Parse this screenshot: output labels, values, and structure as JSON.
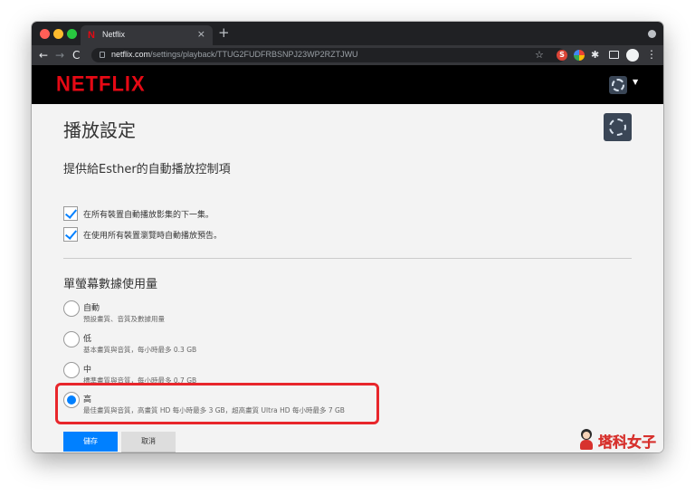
{
  "browser": {
    "tab_title": "Netflix",
    "tab_close": "×",
    "new_tab": "+",
    "url_host": "netflix.com",
    "url_path": "/settings/playback/TTUG2FUDFRBSNPJ23WP2RZTJWU",
    "nav_back": "←",
    "nav_forward": "→",
    "nav_reload": "C",
    "star": "☆",
    "ext_s_label": "S",
    "puzzle": "✱",
    "menu": "⋮"
  },
  "header": {
    "logo": "NETFLIX",
    "caret": "▼"
  },
  "page": {
    "title": "播放設定",
    "autoplay_section_title": "提供給Esther的自動播放控制項",
    "autoplay_options": [
      {
        "label": "在所有裝置自動播放影集的下一集。",
        "checked": true
      },
      {
        "label": "在使用所有裝置瀏覽時自動播放預告。",
        "checked": true
      }
    ],
    "data_section_title": "單螢幕數據使用量",
    "data_options": [
      {
        "label": "自動",
        "desc": "預設畫質、音質及數據用量",
        "selected": false
      },
      {
        "label": "低",
        "desc": "基本畫質與音質，每小時最多 0.3 GB",
        "selected": false
      },
      {
        "label": "中",
        "desc": "標準畫質與音質，每小時最多 0.7 GB",
        "selected": false
      },
      {
        "label": "高",
        "desc": "最佳畫質與音質，高畫質 HD 每小時最多 3 GB，超高畫質 Ultra HD 每小時最多 7 GB",
        "selected": true
      }
    ],
    "save_label": "儲存",
    "cancel_label": "取消"
  },
  "watermark": {
    "text": "塔科女子"
  },
  "colors": {
    "netflix_red": "#e50914",
    "accent_blue": "#0080ff",
    "highlight_red": "#e8262b"
  }
}
